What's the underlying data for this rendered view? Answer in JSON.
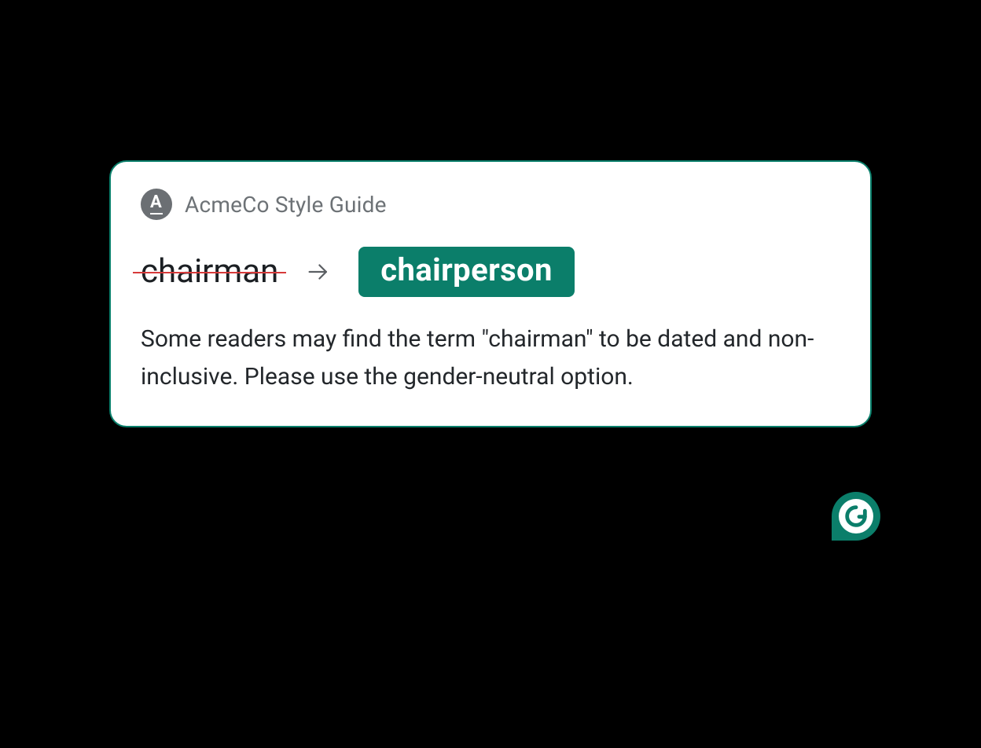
{
  "brand": {
    "letter": "A"
  },
  "card": {
    "title": "AcmeCo Style Guide",
    "old_term": "chairman",
    "new_term": "chairperson",
    "explanation": "Some readers may find the term \"chairman\" to be dated and non-inclusive. Please use the gender-neutral option."
  },
  "colors": {
    "accent": "#0b7e6a",
    "strike": "#d63a3a",
    "badge_gray": "#6b6f73",
    "card_bg": "#ffffff"
  },
  "icons": {
    "arrow": "arrow-right-icon",
    "app_badge": "grammarly-icon"
  }
}
